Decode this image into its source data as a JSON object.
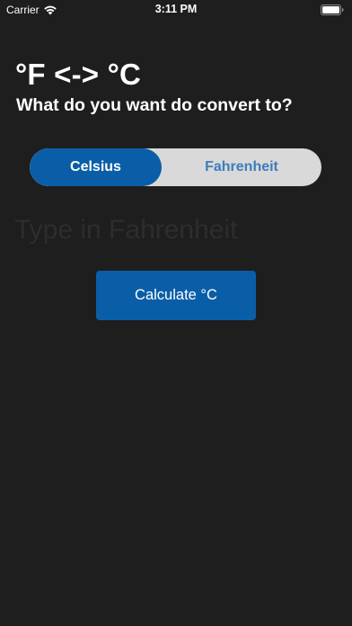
{
  "status_bar": {
    "carrier": "Carrier",
    "time": "3:11 PM",
    "wifi_icon": "wifi-icon",
    "battery_icon": "battery-icon"
  },
  "header": {
    "title": "°F <-> °C",
    "subtitle": "What do you want do convert to?"
  },
  "segmented_control": {
    "options": [
      {
        "label": "Celsius",
        "selected": true
      },
      {
        "label": "Fahrenheit",
        "selected": false
      }
    ]
  },
  "input": {
    "placeholder": "Type in Fahrenheit",
    "value": ""
  },
  "calculate_button": {
    "label": "Calculate °C"
  },
  "colors": {
    "background": "#1e1e1e",
    "accent": "#0a5ea8",
    "segment_track": "#d9d9d9",
    "unselected_text": "#3d7dbe",
    "placeholder": "#2d2d2d"
  }
}
